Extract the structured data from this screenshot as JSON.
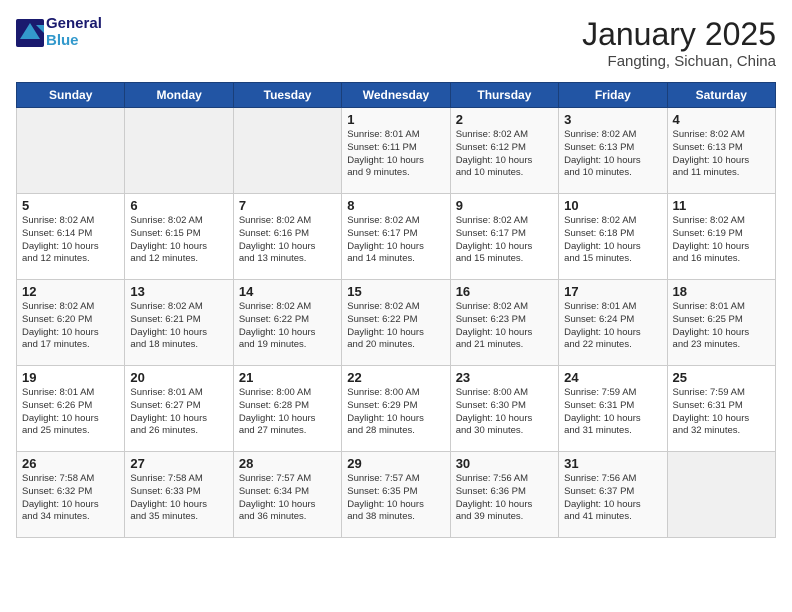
{
  "header": {
    "logo_line1": "General",
    "logo_line2": "Blue",
    "title": "January 2025",
    "subtitle": "Fangting, Sichuan, China"
  },
  "weekdays": [
    "Sunday",
    "Monday",
    "Tuesday",
    "Wednesday",
    "Thursday",
    "Friday",
    "Saturday"
  ],
  "weeks": [
    [
      {
        "day": "",
        "info": ""
      },
      {
        "day": "",
        "info": ""
      },
      {
        "day": "",
        "info": ""
      },
      {
        "day": "1",
        "info": "Sunrise: 8:01 AM\nSunset: 6:11 PM\nDaylight: 10 hours\nand 9 minutes."
      },
      {
        "day": "2",
        "info": "Sunrise: 8:02 AM\nSunset: 6:12 PM\nDaylight: 10 hours\nand 10 minutes."
      },
      {
        "day": "3",
        "info": "Sunrise: 8:02 AM\nSunset: 6:13 PM\nDaylight: 10 hours\nand 10 minutes."
      },
      {
        "day": "4",
        "info": "Sunrise: 8:02 AM\nSunset: 6:13 PM\nDaylight: 10 hours\nand 11 minutes."
      }
    ],
    [
      {
        "day": "5",
        "info": "Sunrise: 8:02 AM\nSunset: 6:14 PM\nDaylight: 10 hours\nand 12 minutes."
      },
      {
        "day": "6",
        "info": "Sunrise: 8:02 AM\nSunset: 6:15 PM\nDaylight: 10 hours\nand 12 minutes."
      },
      {
        "day": "7",
        "info": "Sunrise: 8:02 AM\nSunset: 6:16 PM\nDaylight: 10 hours\nand 13 minutes."
      },
      {
        "day": "8",
        "info": "Sunrise: 8:02 AM\nSunset: 6:17 PM\nDaylight: 10 hours\nand 14 minutes."
      },
      {
        "day": "9",
        "info": "Sunrise: 8:02 AM\nSunset: 6:17 PM\nDaylight: 10 hours\nand 15 minutes."
      },
      {
        "day": "10",
        "info": "Sunrise: 8:02 AM\nSunset: 6:18 PM\nDaylight: 10 hours\nand 15 minutes."
      },
      {
        "day": "11",
        "info": "Sunrise: 8:02 AM\nSunset: 6:19 PM\nDaylight: 10 hours\nand 16 minutes."
      }
    ],
    [
      {
        "day": "12",
        "info": "Sunrise: 8:02 AM\nSunset: 6:20 PM\nDaylight: 10 hours\nand 17 minutes."
      },
      {
        "day": "13",
        "info": "Sunrise: 8:02 AM\nSunset: 6:21 PM\nDaylight: 10 hours\nand 18 minutes."
      },
      {
        "day": "14",
        "info": "Sunrise: 8:02 AM\nSunset: 6:22 PM\nDaylight: 10 hours\nand 19 minutes."
      },
      {
        "day": "15",
        "info": "Sunrise: 8:02 AM\nSunset: 6:22 PM\nDaylight: 10 hours\nand 20 minutes."
      },
      {
        "day": "16",
        "info": "Sunrise: 8:02 AM\nSunset: 6:23 PM\nDaylight: 10 hours\nand 21 minutes."
      },
      {
        "day": "17",
        "info": "Sunrise: 8:01 AM\nSunset: 6:24 PM\nDaylight: 10 hours\nand 22 minutes."
      },
      {
        "day": "18",
        "info": "Sunrise: 8:01 AM\nSunset: 6:25 PM\nDaylight: 10 hours\nand 23 minutes."
      }
    ],
    [
      {
        "day": "19",
        "info": "Sunrise: 8:01 AM\nSunset: 6:26 PM\nDaylight: 10 hours\nand 25 minutes."
      },
      {
        "day": "20",
        "info": "Sunrise: 8:01 AM\nSunset: 6:27 PM\nDaylight: 10 hours\nand 26 minutes."
      },
      {
        "day": "21",
        "info": "Sunrise: 8:00 AM\nSunset: 6:28 PM\nDaylight: 10 hours\nand 27 minutes."
      },
      {
        "day": "22",
        "info": "Sunrise: 8:00 AM\nSunset: 6:29 PM\nDaylight: 10 hours\nand 28 minutes."
      },
      {
        "day": "23",
        "info": "Sunrise: 8:00 AM\nSunset: 6:30 PM\nDaylight: 10 hours\nand 30 minutes."
      },
      {
        "day": "24",
        "info": "Sunrise: 7:59 AM\nSunset: 6:31 PM\nDaylight: 10 hours\nand 31 minutes."
      },
      {
        "day": "25",
        "info": "Sunrise: 7:59 AM\nSunset: 6:31 PM\nDaylight: 10 hours\nand 32 minutes."
      }
    ],
    [
      {
        "day": "26",
        "info": "Sunrise: 7:58 AM\nSunset: 6:32 PM\nDaylight: 10 hours\nand 34 minutes."
      },
      {
        "day": "27",
        "info": "Sunrise: 7:58 AM\nSunset: 6:33 PM\nDaylight: 10 hours\nand 35 minutes."
      },
      {
        "day": "28",
        "info": "Sunrise: 7:57 AM\nSunset: 6:34 PM\nDaylight: 10 hours\nand 36 minutes."
      },
      {
        "day": "29",
        "info": "Sunrise: 7:57 AM\nSunset: 6:35 PM\nDaylight: 10 hours\nand 38 minutes."
      },
      {
        "day": "30",
        "info": "Sunrise: 7:56 AM\nSunset: 6:36 PM\nDaylight: 10 hours\nand 39 minutes."
      },
      {
        "day": "31",
        "info": "Sunrise: 7:56 AM\nSunset: 6:37 PM\nDaylight: 10 hours\nand 41 minutes."
      },
      {
        "day": "",
        "info": ""
      }
    ]
  ]
}
